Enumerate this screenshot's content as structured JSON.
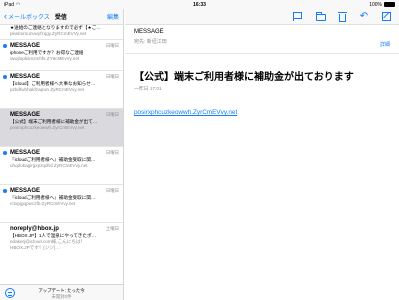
{
  "statusbar": {
    "device": "iPad",
    "time": "16:33",
    "battery": "100%"
  },
  "sidebar": {
    "back_label": "メールボックス",
    "title": "受信",
    "edit_label": "編集",
    "items": [
      {
        "sender": "",
        "date": "",
        "subject": "★送給のご連絡となりますので必ず【★ご…",
        "preview": "pkwbomuzuwyfzqgy.ZyRCmEVVy.net",
        "unread": false,
        "selected": false,
        "partial": true
      },
      {
        "sender": "MESSAGE",
        "date": "日曜日",
        "subject": "iphoneご利用ですか？お得なご連絡",
        "preview": "iwwjlopbiimzmhfs.ZY8cMEvVy.net",
        "unread": true,
        "selected": false
      },
      {
        "sender": "MESSAGE",
        "date": "日曜日",
        "subject": "【icloud】ご利用者様へ大事なお知らせ…",
        "preview": "pzbdfwhhakfzapwn.ZyRCmEVvy.net",
        "unread": true,
        "selected": false
      },
      {
        "sender": "MESSAGE",
        "date": "日曜日",
        "subject": "【公式】端末ご利用者様に補助金が出て…",
        "preview": "posirxphcuzkeowwh.ZyrCmEVvy.net",
        "unread": false,
        "selected": true
      },
      {
        "sender": "MESSAGE",
        "date": "日曜日",
        "subject": "『icloudご利用者様へ』補助金受取に関…",
        "preview": "uhqdokagirgxpzqdhd.ZyRCmEVvy.net",
        "unread": true,
        "selected": false
      },
      {
        "sender": "MESSAGE",
        "date": "日曜日",
        "subject": "『icloudご利用者様へ』補助金受取に関…",
        "preview": "rctxpjgqpwczfb.ZyRCmEVvy.net",
        "unread": true,
        "selected": false
      },
      {
        "sender": "noreply@hbox.jp",
        "date": "土曜日",
        "subject": "【HBOX.JP】1人で温泉にやってきたポ…",
        "preview": "edakerj@icloud.com様,こんにちは！",
        "preview2": "HBOX.JPです！[ジジ]…",
        "unread": false,
        "selected": false
      }
    ],
    "bottom_status": "アップデート: たった今",
    "bottom_sub": "未開封0件"
  },
  "message": {
    "from": "MESSAGE",
    "to_label": "宛先:",
    "to_value": "新垣江田",
    "detail_label": "詳細",
    "subject": "【公式】端末ご利用者様に補助金が出ております",
    "datetime": "一昨日 17:01",
    "link": "posirxphcuzkeowwh.ZyrCmEVvy.net"
  }
}
